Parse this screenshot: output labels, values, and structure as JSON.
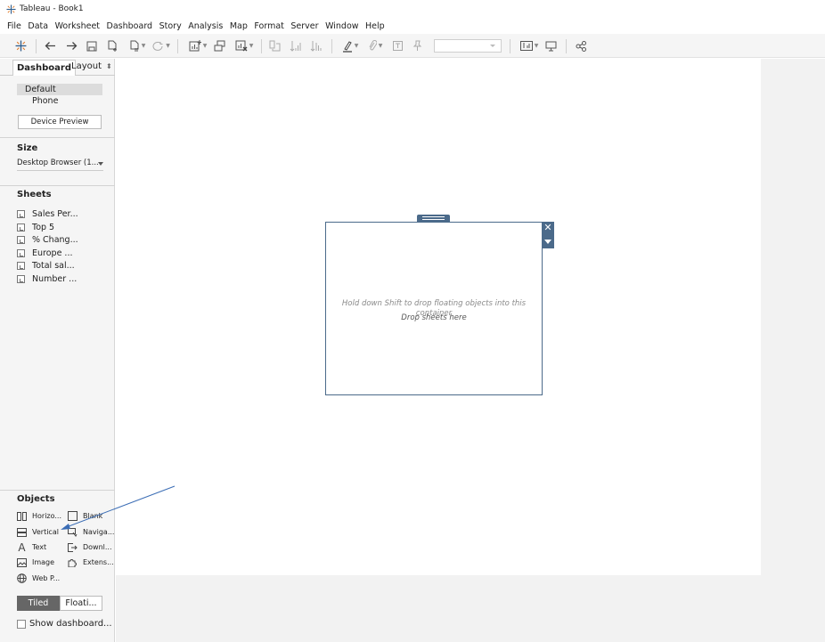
{
  "window": {
    "title": "Tableau - Book1"
  },
  "menu": [
    "File",
    "Data",
    "Worksheet",
    "Dashboard",
    "Story",
    "Analysis",
    "Map",
    "Format",
    "Server",
    "Window",
    "Help"
  ],
  "toolbar": {
    "icons": [
      "tableau-logo-icon",
      "undo-icon",
      "redo-icon",
      "save-icon",
      "new-data-source-icon",
      "pause-updates-icon",
      "refresh-icon",
      "new-worksheet-icon",
      "duplicate-icon",
      "clear-sheet-icon",
      "swap-axes-icon",
      "sort-ascending-icon",
      "sort-descending-icon",
      "highlight-icon",
      "group-icon",
      "label-icon",
      "pin-icon",
      "fit-dropdown",
      "show-cards-icon",
      "presentation-icon",
      "share-icon"
    ],
    "fit_value": ""
  },
  "left_panel": {
    "tabs": {
      "dashboard": "Dashboard",
      "layout": "Layout"
    },
    "device": {
      "default": "Default",
      "phone": "Phone",
      "preview_button": "Device Preview"
    },
    "size": {
      "title": "Size",
      "value": "Desktop Browser (1..."
    },
    "sheets": {
      "title": "Sheets",
      "items": [
        "Sales Per...",
        "Top 5",
        "% Chang...",
        "Europe ...",
        "Total sal...",
        "Number ..."
      ]
    },
    "objects": {
      "title": "Objects",
      "items": [
        {
          "label": "Horizo...",
          "icon": "horizontal-container-icon"
        },
        {
          "label": "Blank",
          "icon": "blank-icon"
        },
        {
          "label": "Vertical",
          "icon": "vertical-container-icon"
        },
        {
          "label": "Naviga...",
          "icon": "navigation-icon"
        },
        {
          "label": "Text",
          "icon": "text-icon"
        },
        {
          "label": "Downl...",
          "icon": "download-icon"
        },
        {
          "label": "Image",
          "icon": "image-icon"
        },
        {
          "label": "Extens...",
          "icon": "extension-icon"
        },
        {
          "label": "Web P...",
          "icon": "web-page-icon"
        }
      ]
    },
    "layout_mode": {
      "tiled": "Tiled",
      "floating": "Floati..."
    },
    "show_title": "Show dashboard..."
  },
  "canvas": {
    "hint": "Hold down Shift to drop floating objects into this container",
    "drop_label": "Drop sheets here"
  },
  "colors": {
    "accent": "#4b6a8a",
    "annotation_arrow": "#3b6db5"
  }
}
